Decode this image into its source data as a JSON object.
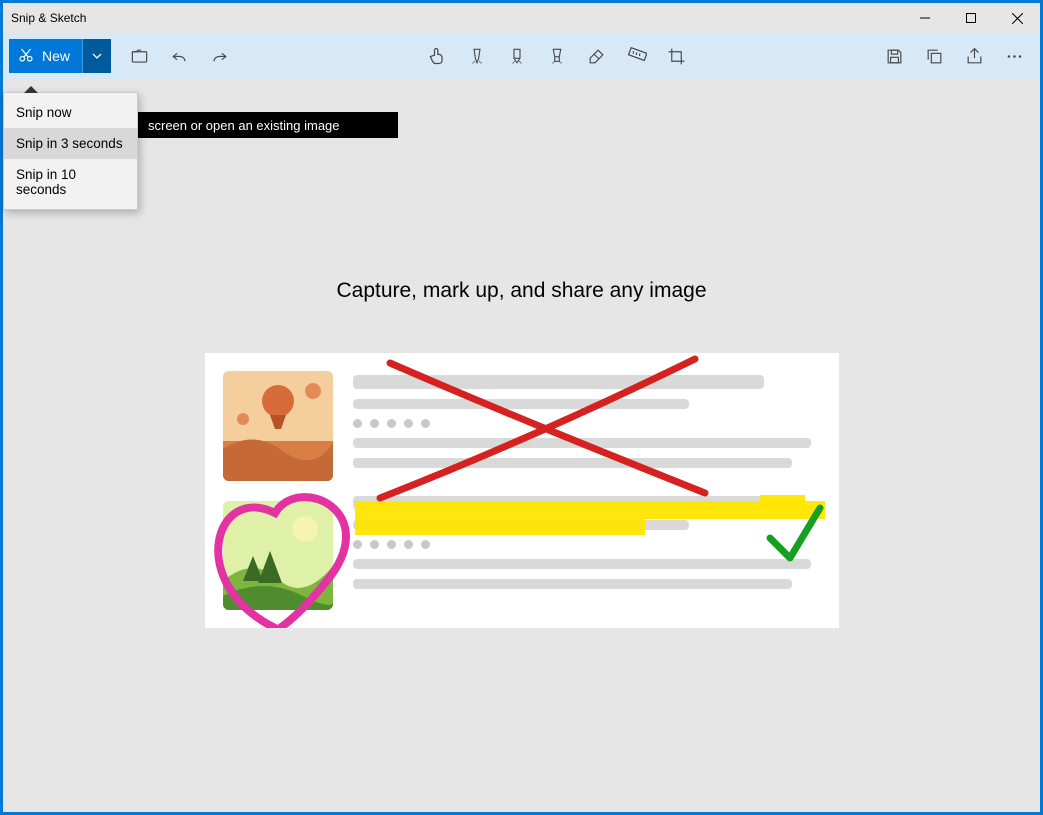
{
  "app": {
    "title": "Snip & Sketch"
  },
  "toolbar": {
    "new_label": "New",
    "tools": [
      {
        "name": "open-file-icon"
      },
      {
        "name": "undo-icon"
      },
      {
        "name": "redo-icon"
      }
    ],
    "center_tools": [
      {
        "name": "touch-writing-icon"
      },
      {
        "name": "ballpoint-pen-icon"
      },
      {
        "name": "pencil-icon"
      },
      {
        "name": "highlighter-icon"
      },
      {
        "name": "eraser-icon"
      },
      {
        "name": "ruler-icon"
      },
      {
        "name": "crop-icon"
      }
    ],
    "right_tools": [
      {
        "name": "save-icon"
      },
      {
        "name": "copy-icon"
      },
      {
        "name": "share-icon"
      },
      {
        "name": "more-icon"
      }
    ]
  },
  "dropdown": {
    "items": [
      {
        "label": "Snip now",
        "selected": false
      },
      {
        "label": "Snip in 3 seconds",
        "selected": true
      },
      {
        "label": "Snip in 10 seconds",
        "selected": false
      }
    ]
  },
  "tooltip": {
    "text": "screen or open an existing image"
  },
  "content": {
    "caption": "Capture, mark up, and share any image"
  },
  "colors": {
    "accent": "#0078d7",
    "toolbar_bg": "#d7e8f7",
    "content_bg": "#e6e6e6",
    "red_ink": "#d62121",
    "pink_ink": "#e333a3",
    "yellow_hl": "#ffe600",
    "green_ink": "#16a020"
  }
}
